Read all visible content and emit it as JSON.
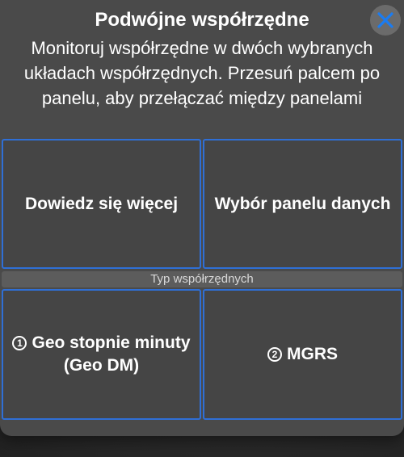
{
  "dialog": {
    "title": "Podwójne współrzędne",
    "description": "Monitoruj współrzędne w dwóch wybranych układach współrzędnych. Przesuń palcem po panelu, aby przełączać między panelami",
    "close_icon": "close-icon"
  },
  "actions": {
    "learn_more": "Dowiedz się więcej",
    "panel_selection": "Wybór panelu danych"
  },
  "coordinate_types": {
    "header": "Typ współrzędnych",
    "options": [
      {
        "number": "1",
        "label_line1": "Geo stopnie minuty",
        "label_line2": "(Geo DM)"
      },
      {
        "number": "2",
        "label": "MGRS"
      }
    ]
  },
  "colors": {
    "accent_blue": "#2f6fd6",
    "close_x": "#1a7cf2"
  }
}
